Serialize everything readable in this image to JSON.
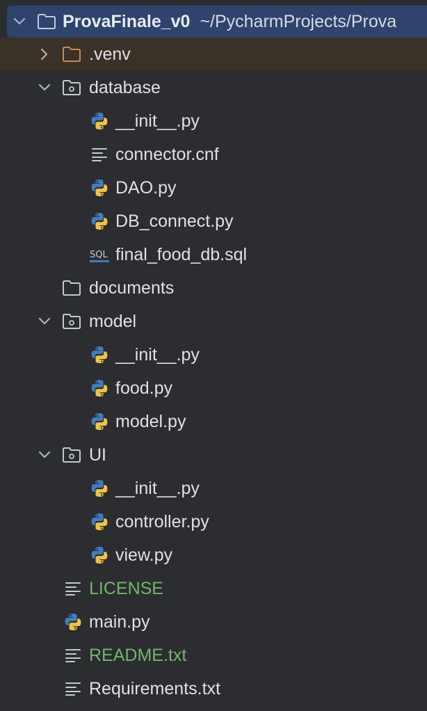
{
  "root": {
    "name": "ProvaFinale_v0",
    "path": "~/PycharmProjects/Prova"
  },
  "items": [
    {
      "label": ".venv",
      "icon": "folder-excluded-icon"
    },
    {
      "label": "database",
      "icon": "package-folder-icon"
    },
    {
      "label": "__init__.py",
      "icon": "python-file-icon"
    },
    {
      "label": "connector.cnf",
      "icon": "text-file-icon"
    },
    {
      "label": "DAO.py",
      "icon": "python-file-icon"
    },
    {
      "label": "DB_connect.py",
      "icon": "python-file-icon"
    },
    {
      "label": "final_food_db.sql",
      "icon": "sql-file-icon"
    },
    {
      "label": "documents",
      "icon": "folder-icon"
    },
    {
      "label": "model",
      "icon": "package-folder-icon"
    },
    {
      "label": "__init__.py",
      "icon": "python-file-icon"
    },
    {
      "label": "food.py",
      "icon": "python-file-icon"
    },
    {
      "label": "model.py",
      "icon": "python-file-icon"
    },
    {
      "label": "UI",
      "icon": "package-folder-icon"
    },
    {
      "label": "__init__.py",
      "icon": "python-file-icon"
    },
    {
      "label": "controller.py",
      "icon": "python-file-icon"
    },
    {
      "label": "view.py",
      "icon": "python-file-icon"
    },
    {
      "label": "LICENSE",
      "icon": "text-file-icon"
    },
    {
      "label": "main.py",
      "icon": "python-file-icon"
    },
    {
      "label": "README.txt",
      "icon": "text-file-icon"
    },
    {
      "label": "Requirements.txt",
      "icon": "text-file-icon"
    }
  ],
  "colors": {
    "background": "#2b2d30",
    "root_selection": "#2e436e",
    "excluded_row": "#3a3127",
    "untracked_text": "#73b56d",
    "python_blue": "#3f7dc1",
    "python_yellow": "#f0c341",
    "excluded_folder": "#c9875a"
  }
}
